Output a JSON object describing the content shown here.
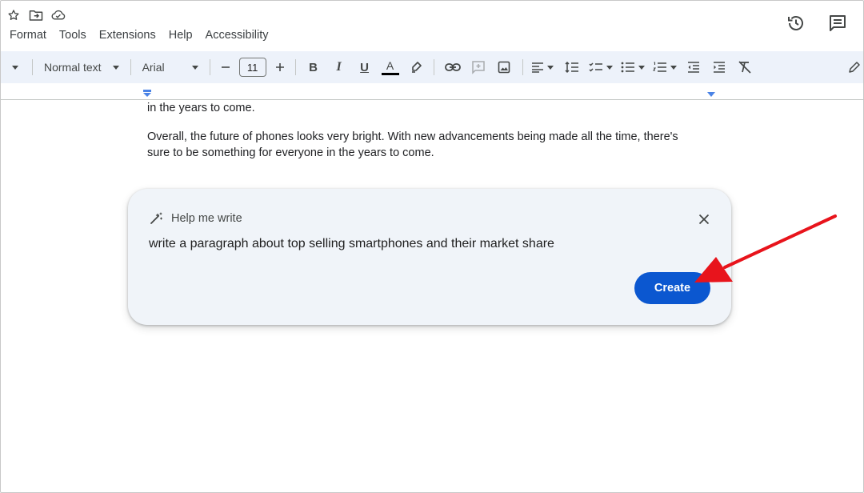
{
  "menubar": {
    "items": [
      "Format",
      "Tools",
      "Extensions",
      "Help",
      "Accessibility"
    ]
  },
  "toolbar": {
    "style_label": "Normal text",
    "font_label": "Arial",
    "font_size": "11"
  },
  "document": {
    "line_1": "in the years to come.",
    "paragraph_1": "Overall, the future of phones looks very bright. With new advancements being made all the time, there's",
    "paragraph_2": "sure to be something for everyone in the years to come."
  },
  "help_me_write": {
    "title": "Help me write",
    "prompt": "write a paragraph about top selling smartphones and their market share",
    "create_label": "Create"
  },
  "colors": {
    "accent": "#0b57d0",
    "toolbar_bg": "#edf2fa",
    "card_bg": "#f0f4f9",
    "arrow": "#e8141c"
  },
  "icons": {
    "title": [
      "star-icon",
      "move-to-folder-icon",
      "cloud-status-icon"
    ],
    "top_right": [
      "version-history-icon",
      "comments-icon"
    ]
  }
}
